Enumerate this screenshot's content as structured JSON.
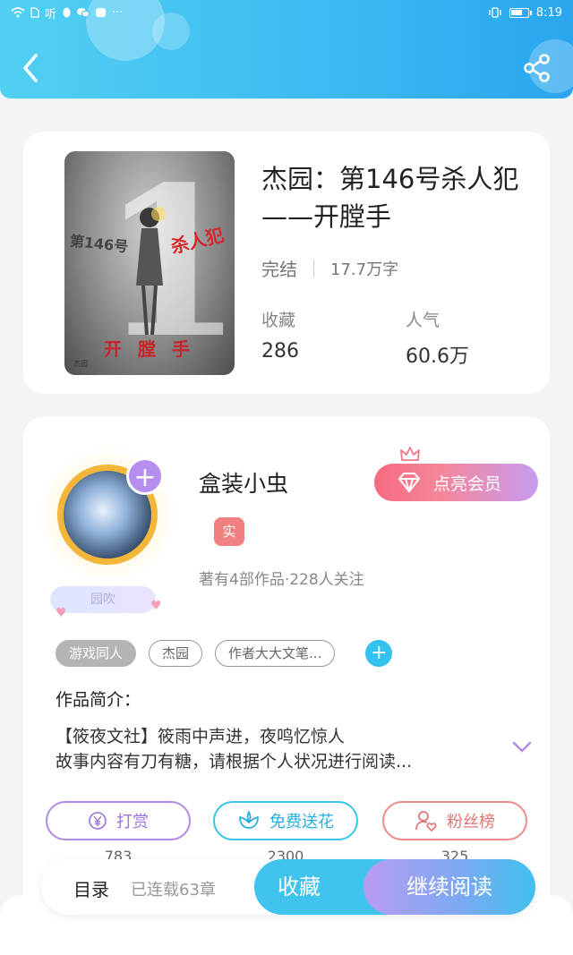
{
  "status_bar": {
    "left_icons": [
      "wifi-icon",
      "sim-icon",
      "听",
      "qq-icon",
      "wechat-icon",
      "cloud-icon",
      "···"
    ],
    "time": "8:19"
  },
  "header": {
    "back_icon": "chevron-left-icon",
    "share_icon": "share-icon",
    "background_colors": [
      "#52d0f2",
      "#2aa6ef"
    ]
  },
  "book": {
    "cover": {
      "big_number": "1",
      "text_number": "第146号",
      "text_killer": "杀人犯",
      "text_ripper": "开膛手",
      "text_small": "杰园"
    },
    "title": "杰园：第146号杀人犯——开膛手",
    "status": "完结",
    "word_count": "17.7万字",
    "favorites_label": "收藏",
    "favorites_value": "286",
    "popularity_label": "人气",
    "popularity_value": "60.6万"
  },
  "author": {
    "name": "盒装小虫",
    "follow_icon": "plus-icon",
    "verified_badge": "实",
    "stats": "著有4部作品·228人关注",
    "fan_badge": "园吹",
    "vip_button": "点亮会员",
    "vip_icon": "diamond-icon"
  },
  "tags": [
    "游戏同人",
    "杰园",
    "作者大大文笔..."
  ],
  "intro": {
    "title": "作品简介：",
    "line1": "【筱夜文社】筱雨中声进，夜鸣忆惊人",
    "line2": "故事内容有刀有糖，请根据个人状况进行阅读..."
  },
  "actions": [
    {
      "label": "打赏",
      "count": "783",
      "icon": "yen-coin-icon",
      "color": "#9a74d8"
    },
    {
      "label": "免费送花",
      "count": "2300",
      "icon": "flower-icon",
      "color": "#27b0de"
    },
    {
      "label": "粉丝榜",
      "count": "325",
      "icon": "user-heart-icon",
      "color": "#e17575"
    }
  ],
  "bottom_bar": {
    "toc": "目录",
    "toc_status": "已连载63章",
    "favorite": "收藏",
    "continue_reading": "继续阅读"
  }
}
